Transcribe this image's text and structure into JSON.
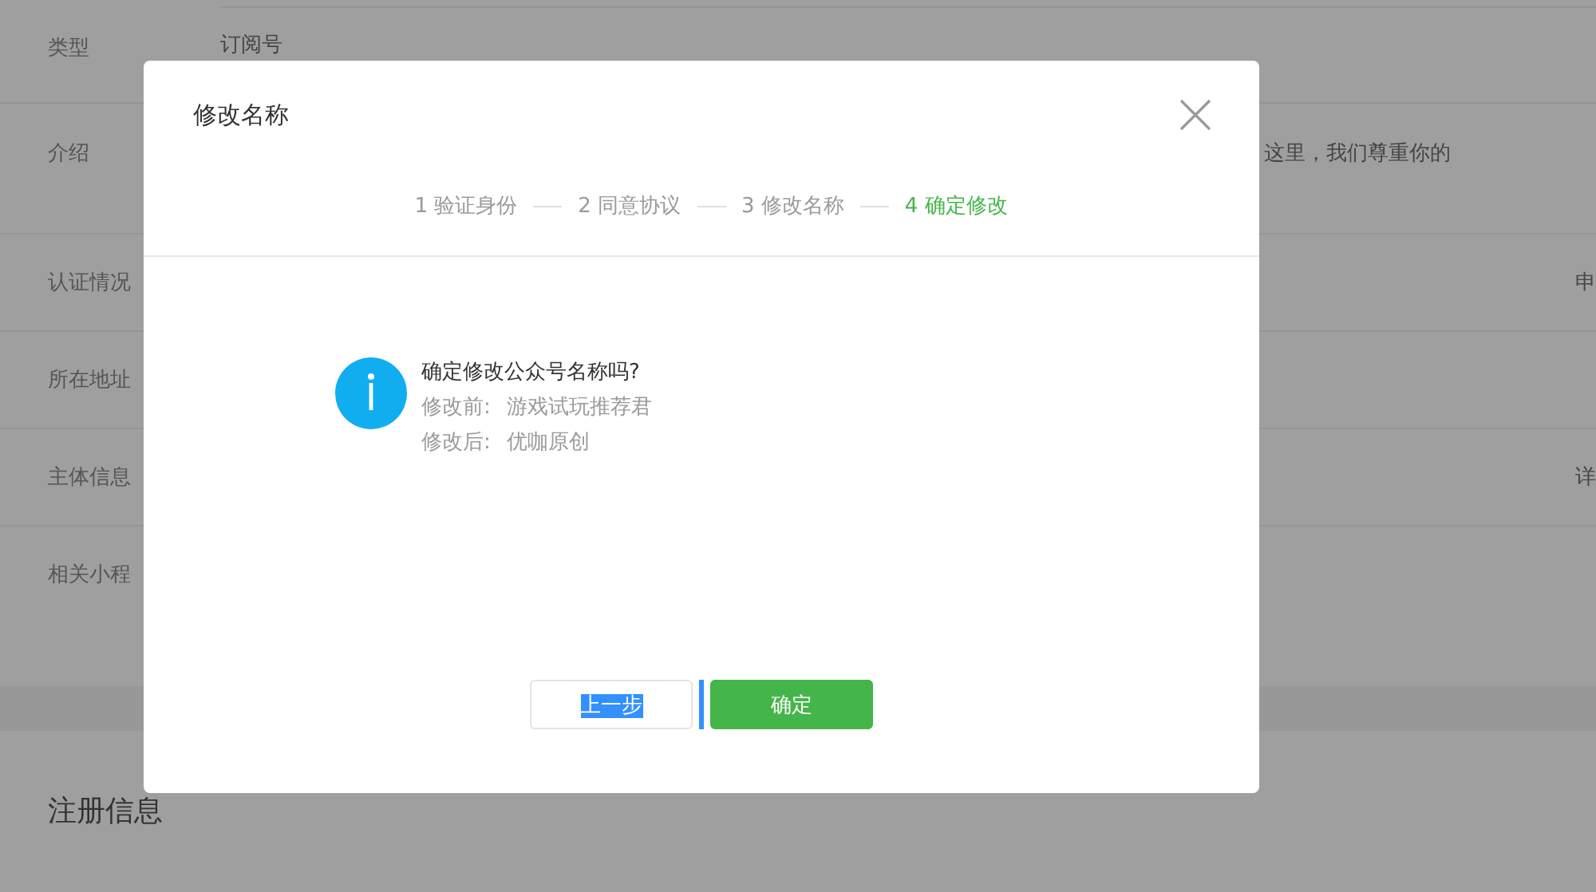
{
  "background": {
    "rows": [
      {
        "label": "类型",
        "value": "订阅号"
      },
      {
        "label": "介绍",
        "side_value": "这里，我们尊重你的"
      },
      {
        "label": "认证情况",
        "side_value": "申"
      },
      {
        "label": "所在地址"
      },
      {
        "label": "主体信息",
        "side_value": "详"
      },
      {
        "label": "相关小程"
      }
    ],
    "section_title": "注册信息"
  },
  "dialog": {
    "title": "修改名称",
    "steps": [
      {
        "label": "1 验证身份",
        "selected": false
      },
      {
        "label": "2 同意协议",
        "selected": false
      },
      {
        "label": "3 修改名称",
        "selected": false
      },
      {
        "label": "4 确定修改",
        "selected": true
      }
    ],
    "question": "确定修改公众号名称吗?",
    "details": [
      {
        "label": "修改前:",
        "value": "游戏试玩推荐君"
      },
      {
        "label": "修改后:",
        "value": "优咖原创"
      }
    ],
    "buttons": [
      {
        "label": "上一步",
        "kind": "secondary",
        "text_selected": true
      },
      {
        "label": "确定",
        "kind": "primary",
        "text_selected": false
      }
    ]
  }
}
